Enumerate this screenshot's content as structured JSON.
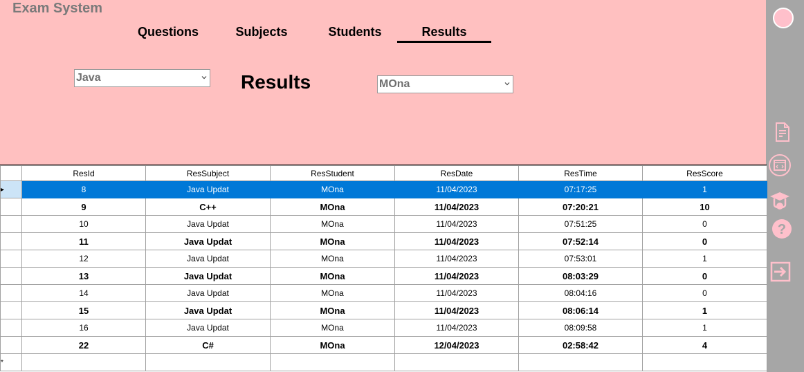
{
  "app": {
    "title": "Exam System"
  },
  "nav": {
    "tabs": [
      {
        "label": "Questions"
      },
      {
        "label": "Subjects"
      },
      {
        "label": "Students"
      },
      {
        "label": "Results"
      }
    ]
  },
  "filters": {
    "subject_value": "Java",
    "student_value": "MOna"
  },
  "page": {
    "heading": "Results"
  },
  "sidebar": {
    "icons": [
      "avatar",
      "document-icon",
      "code-window-icon",
      "graduate-icon",
      "help-icon",
      "logout-icon"
    ]
  },
  "colors": {
    "header_bg": "#ffc0c0",
    "sidebar_bg": "#a6a6a6",
    "selection": "#0078d7",
    "icon_pink": "#ffc0cb"
  },
  "grid": {
    "columns": [
      "ResId",
      "ResSubject",
      "ResStudent",
      "ResDate",
      "ResTime",
      "ResScore"
    ],
    "rows": [
      {
        "cells": [
          "8",
          "Java Updat",
          "MOna",
          "11/04/2023",
          "07:17:25",
          "1"
        ],
        "marker": "▸"
      },
      {
        "cells": [
          "9",
          "C++",
          "MOna",
          "11/04/2023",
          "07:20:21",
          "10"
        ],
        "marker": ""
      },
      {
        "cells": [
          "10",
          "Java Updat",
          "MOna",
          "11/04/2023",
          "07:51:25",
          "0"
        ],
        "marker": ""
      },
      {
        "cells": [
          "11",
          "Java Updat",
          "MOna",
          "11/04/2023",
          "07:52:14",
          "0"
        ],
        "marker": ""
      },
      {
        "cells": [
          "12",
          "Java Updat",
          "MOna",
          "11/04/2023",
          "07:53:01",
          "1"
        ],
        "marker": ""
      },
      {
        "cells": [
          "13",
          "Java Updat",
          "MOna",
          "11/04/2023",
          "08:03:29",
          "0"
        ],
        "marker": ""
      },
      {
        "cells": [
          "14",
          "Java Updat",
          "MOna",
          "11/04/2023",
          "08:04:16",
          "0"
        ],
        "marker": ""
      },
      {
        "cells": [
          "15",
          "Java Updat",
          "MOna",
          "11/04/2023",
          "08:06:14",
          "1"
        ],
        "marker": ""
      },
      {
        "cells": [
          "16",
          "Java Updat",
          "MOna",
          "11/04/2023",
          "08:09:58",
          "1"
        ],
        "marker": ""
      },
      {
        "cells": [
          "22",
          "C#",
          "MOna",
          "12/04/2023",
          "02:58:42",
          "4"
        ],
        "marker": ""
      },
      {
        "cells": [
          "",
          "",
          "",
          "",
          "",
          ""
        ],
        "marker": "*"
      }
    ]
  }
}
